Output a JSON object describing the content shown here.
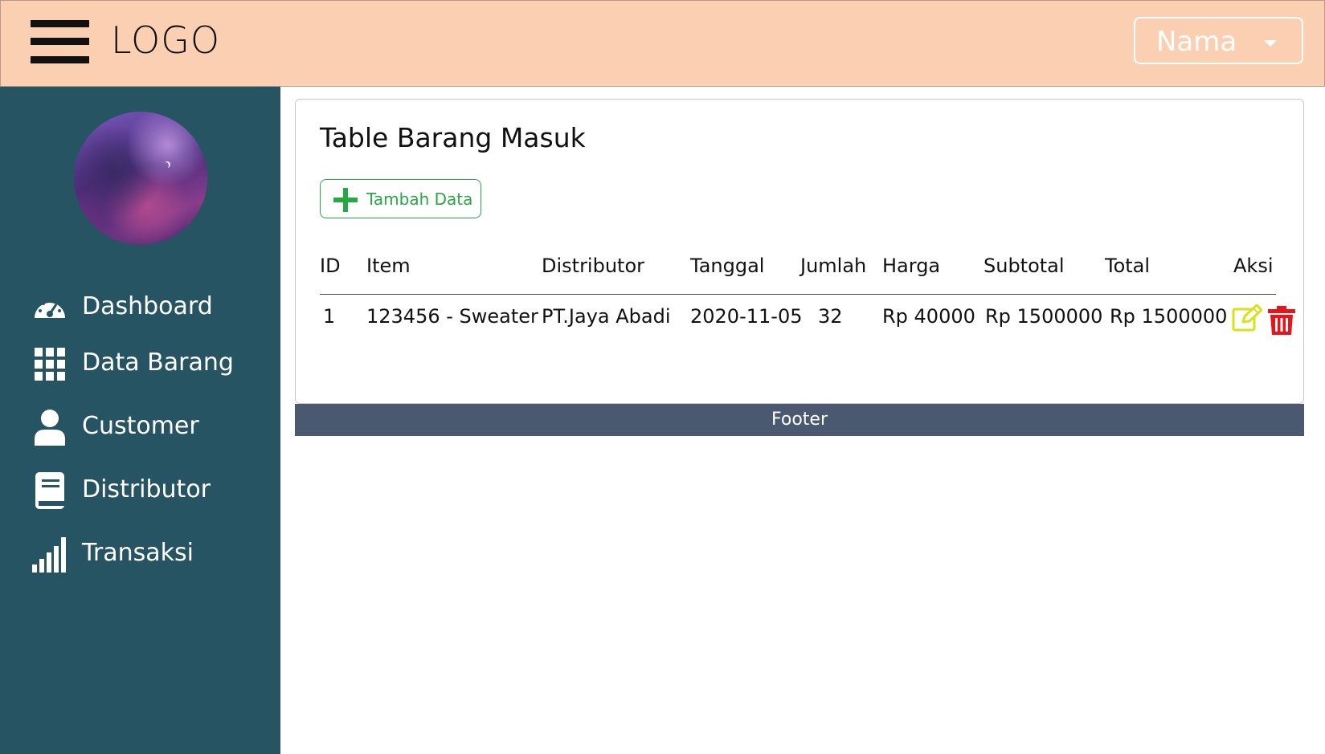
{
  "header": {
    "logo": "LOGO",
    "user_name": "Nama"
  },
  "sidebar": {
    "items": [
      {
        "label": "Dashboard",
        "icon": "dashboard-gauge-icon"
      },
      {
        "label": "Data Barang",
        "icon": "grid-icon"
      },
      {
        "label": "Customer",
        "icon": "user-icon"
      },
      {
        "label": "Distributor",
        "icon": "book-icon"
      },
      {
        "label": "Transaksi",
        "icon": "signal-bars-icon"
      }
    ]
  },
  "main": {
    "title": "Table Barang Masuk",
    "add_button": "Tambah Data",
    "table": {
      "headers": [
        "ID",
        "Item",
        "Distributor",
        "Tanggal",
        "Jumlah",
        "Harga",
        "Subtotal",
        "Total",
        "Aksi"
      ],
      "rows": [
        [
          "1",
          "123456 - Sweater",
          "PT.Jaya Abadi",
          "2020-11-05",
          "32",
          "Rp 40000",
          "Rp 1500000",
          "Rp 1500000"
        ]
      ]
    }
  },
  "footer": {
    "text": "Footer"
  },
  "colors": {
    "header_bg": "#fbcfb1",
    "sidebar_bg": "#275462",
    "footer_bg": "#4a5870",
    "accent_green": "#28a745",
    "edit_yellow": "#d6e21a",
    "delete_red": "#e8141b"
  }
}
